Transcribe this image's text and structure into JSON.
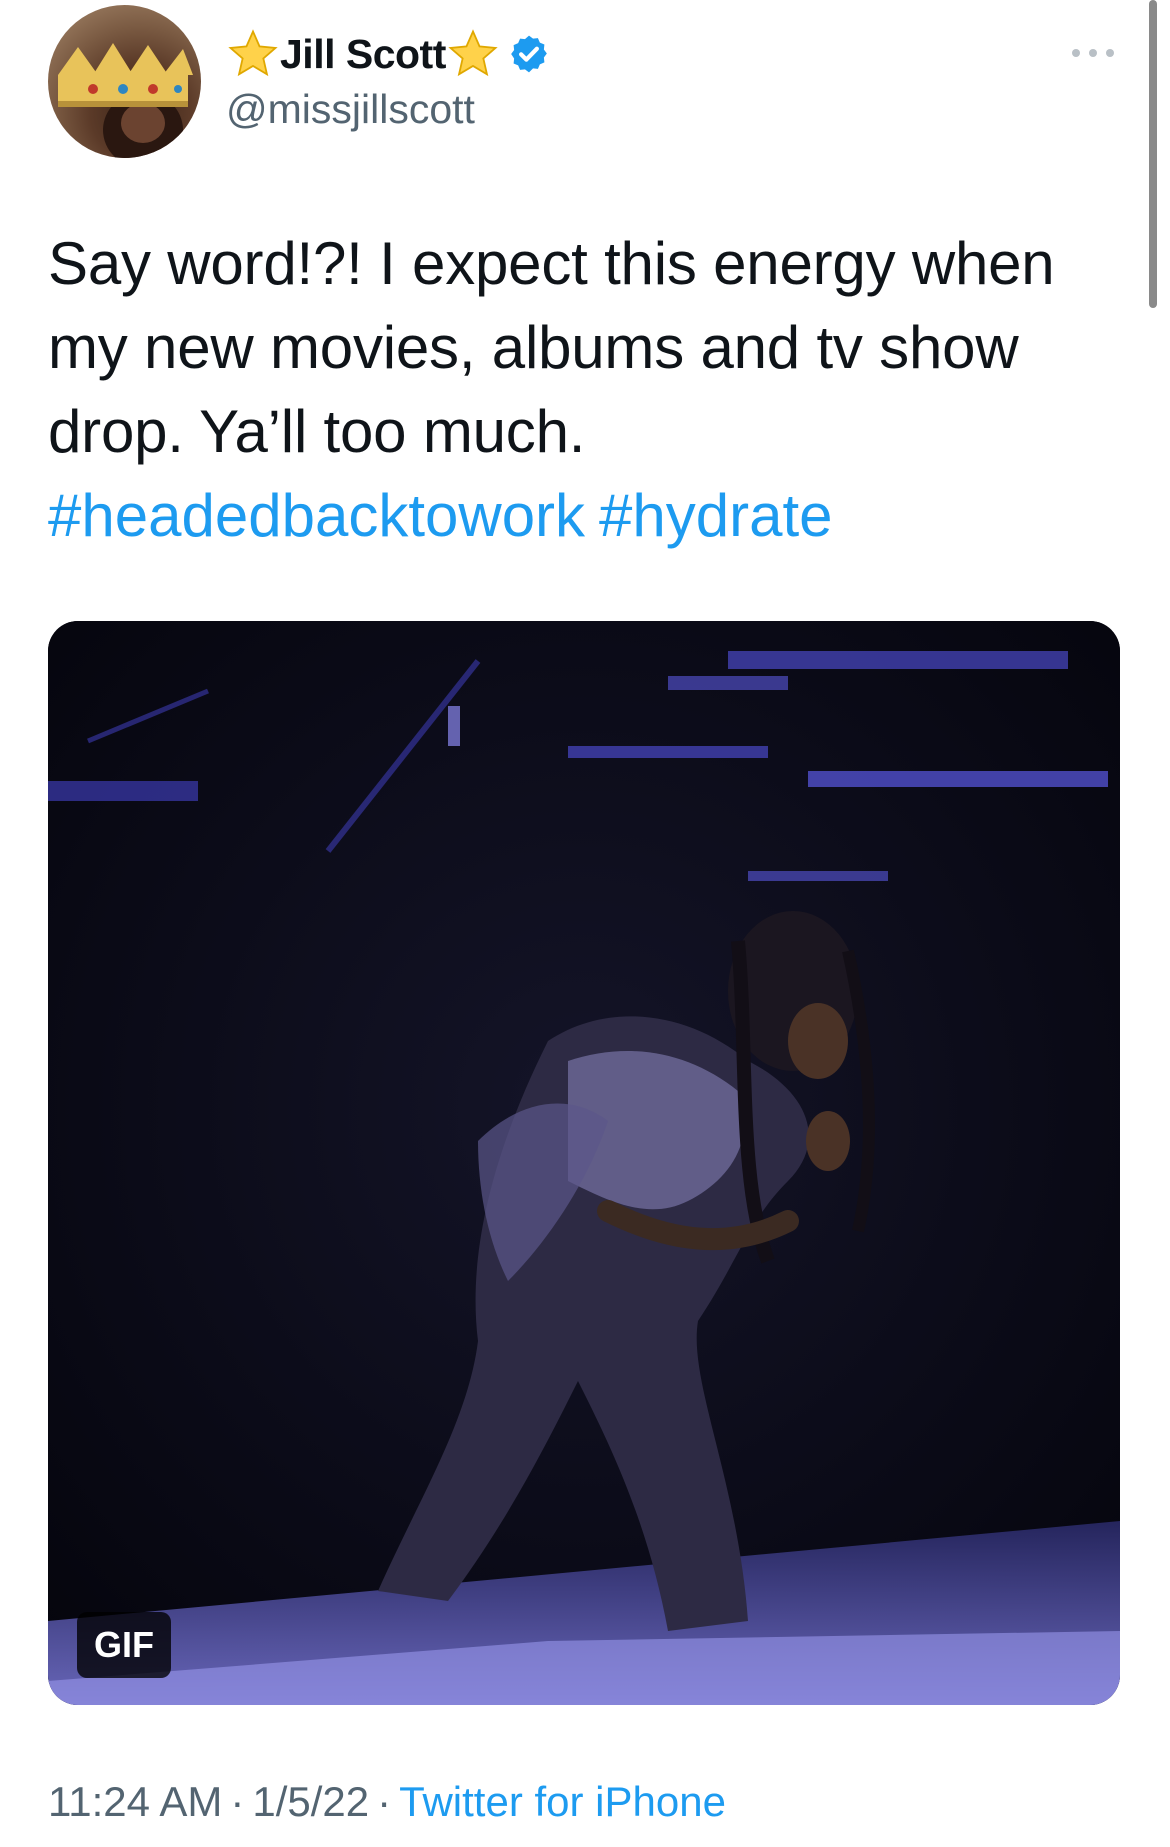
{
  "author": {
    "display_name": "Jill Scott",
    "handle": "@missjillscott",
    "avatar_icon": "crowned-avatar",
    "name_decoration_icon": "star-icon",
    "verified_icon": "verified-badge-icon"
  },
  "tweet": {
    "text": "Say word!?! I expect this energy when my new movies, albums and tv show drop. Ya’ll too much.",
    "hashtags": [
      "#headedbacktowork",
      "#hydrate"
    ],
    "media": {
      "type": "gif",
      "badge": "GIF"
    }
  },
  "meta": {
    "time": "11:24 AM",
    "separator": "·",
    "date": "1/5/22",
    "source": "Twitter for iPhone"
  },
  "colors": {
    "link": "#1d9bf0",
    "secondary": "#536471",
    "text": "#0f1419"
  }
}
